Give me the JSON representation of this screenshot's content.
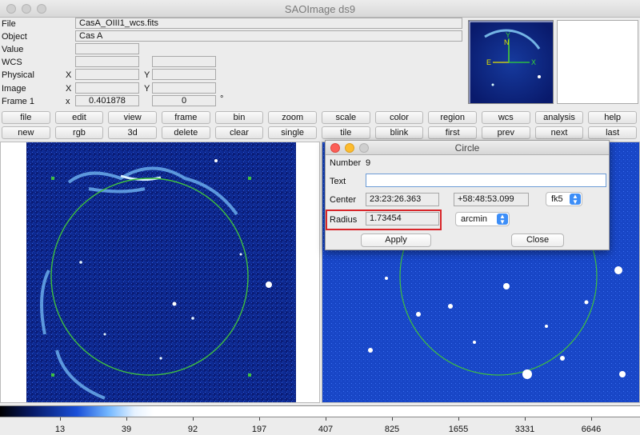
{
  "window": {
    "title": "SAOImage ds9"
  },
  "info": {
    "labels": {
      "file": "File",
      "object": "Object",
      "value": "Value",
      "wcs": "WCS",
      "physical": "Physical",
      "image": "Image",
      "frame": "Frame 1"
    },
    "file": "CasA_OIII1_wcs.fits",
    "object": "Cas A",
    "value": "",
    "axis_x": "X",
    "axis_y": "Y",
    "axis_x_small": "x",
    "zoom": "0.401878",
    "angle": "0",
    "angle_unit": "°"
  },
  "panner": {
    "north": "N",
    "east": "E",
    "x_axis": "X",
    "y_axis": "Y"
  },
  "menu_row1": [
    "file",
    "edit",
    "view",
    "frame",
    "bin",
    "zoom",
    "scale",
    "color",
    "region",
    "wcs",
    "analysis",
    "help"
  ],
  "menu_row2": [
    "new",
    "rgb",
    "3d",
    "delete",
    "clear",
    "single",
    "tile",
    "blink",
    "first",
    "prev",
    "next",
    "last"
  ],
  "dialog": {
    "title": "Circle",
    "number_label": "Number",
    "number": "9",
    "text_label": "Text",
    "text_value": "",
    "center_label": "Center",
    "center_ra": "23:23:26.363",
    "center_dec": "+58:48:53.099",
    "coord_system": "fk5",
    "radius_label": "Radius",
    "radius": "1.73454",
    "radius_unit": "arcmin",
    "apply": "Apply",
    "close": "Close"
  },
  "colorbar": {
    "ticks": [
      "13",
      "39",
      "92",
      "197",
      "407",
      "825",
      "1655",
      "3331",
      "6646"
    ]
  },
  "colors": {
    "accent": "#3d8ef7",
    "highlight": "#d8262a",
    "region": "#3fbf3f"
  }
}
